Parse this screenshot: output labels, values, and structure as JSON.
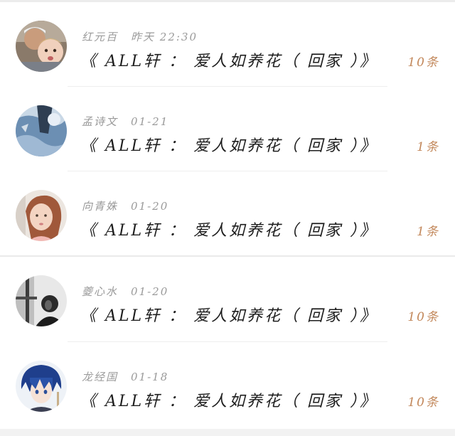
{
  "comments": [
    {
      "author": "红元百",
      "time": "昨天 22:30",
      "title": "《 ALL轩 ： 爱人如养花（ 回家 ）》",
      "count": "10条",
      "avatar_icon": "avatar-man-with-child"
    },
    {
      "author": "孟诗文",
      "time": "01-21",
      "title": "《 ALL轩 ： 爱人如养花（ 回家 ）》",
      "count": "1条",
      "avatar_icon": "avatar-blue-abstract"
    },
    {
      "author": "向青姝",
      "time": "01-20",
      "title": "《 ALL轩 ： 爱人如养花（ 回家 ）》",
      "count": "1条",
      "avatar_icon": "avatar-little-girl"
    },
    {
      "author": "夔心水",
      "time": "01-20",
      "title": "《 ALL轩 ： 爱人如养花（ 回家 ）》",
      "count": "10条",
      "avatar_icon": "avatar-grayscale-person"
    },
    {
      "author": "龙经国",
      "time": "01-18",
      "title": "《 ALL轩 ： 爱人如养花（ 回家 ）》",
      "count": "10条",
      "avatar_icon": "avatar-anime-boy"
    }
  ],
  "colors": {
    "count": "#c2875a",
    "meta": "#9a9a9a",
    "title": "#1e1e1e",
    "divider": "#eeeeee"
  }
}
